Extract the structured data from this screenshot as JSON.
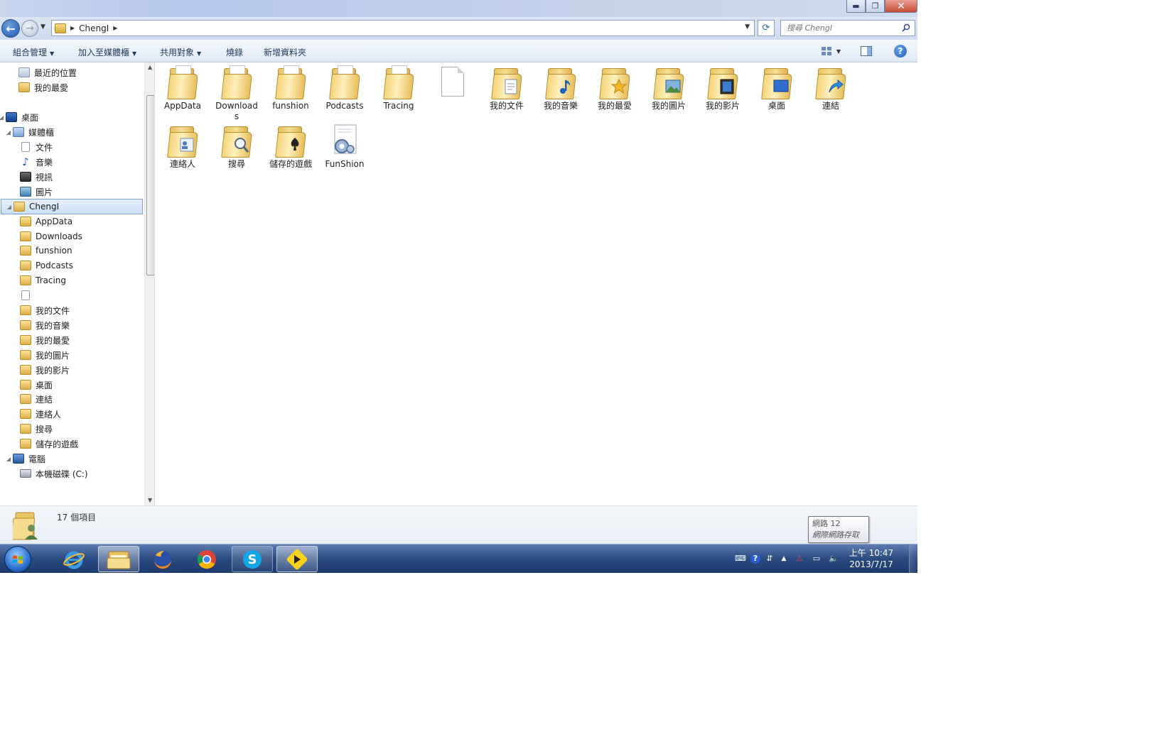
{
  "window": {
    "address_path": "ChengI",
    "search_placeholder": "搜尋 ChengI",
    "controls": {
      "minimize": "▬",
      "maximize": "❐",
      "close": "✕"
    }
  },
  "command_bar": {
    "organize": "組合管理",
    "add_to_library": "加入至媒體櫃",
    "share_with": "共用對象",
    "burn": "燒錄",
    "new_folder": "新增資料夾"
  },
  "nav_tree": [
    {
      "label": "最近的位置",
      "icon": "recent-places-icon"
    },
    {
      "label": "我的最愛",
      "icon": "favorites-icon"
    },
    {
      "label": "桌面",
      "icon": "desktop-icon",
      "expanded": true
    },
    {
      "label": "媒體櫃",
      "icon": "libraries-icon",
      "expanded": true
    },
    {
      "label": "文件",
      "icon": "document-icon"
    },
    {
      "label": "音樂",
      "icon": "music-icon"
    },
    {
      "label": "視訊",
      "icon": "video-icon"
    },
    {
      "label": "圖片",
      "icon": "picture-icon"
    },
    {
      "label": "ChengI",
      "icon": "user-folder-icon",
      "selected": true,
      "expanded": true
    },
    {
      "label": "AppData",
      "icon": "folder-icon"
    },
    {
      "label": "Downloads",
      "icon": "folder-icon"
    },
    {
      "label": "funshion",
      "icon": "folder-icon"
    },
    {
      "label": "Podcasts",
      "icon": "folder-icon"
    },
    {
      "label": "Tracing",
      "icon": "folder-icon"
    },
    {
      "label": "",
      "icon": "blank-file-icon"
    },
    {
      "label": "我的文件",
      "icon": "folder-icon"
    },
    {
      "label": "我的音樂",
      "icon": "folder-icon"
    },
    {
      "label": "我的最愛",
      "icon": "folder-icon"
    },
    {
      "label": "我的圖片",
      "icon": "folder-icon"
    },
    {
      "label": "我的影片",
      "icon": "folder-icon"
    },
    {
      "label": "桌面",
      "icon": "folder-icon"
    },
    {
      "label": "連結",
      "icon": "folder-icon"
    },
    {
      "label": "連絡人",
      "icon": "folder-icon"
    },
    {
      "label": "搜尋",
      "icon": "folder-icon"
    },
    {
      "label": "儲存的遊戲",
      "icon": "folder-icon"
    },
    {
      "label": "電腦",
      "icon": "computer-icon",
      "expanded": true
    },
    {
      "label": "本機磁碟 (C:)",
      "icon": "drive-icon"
    }
  ],
  "items": [
    {
      "label": "AppData",
      "icon": "folder-icon",
      "badge": ""
    },
    {
      "label": "Downloads",
      "icon": "folder-icon",
      "badge": ""
    },
    {
      "label": "funshion",
      "icon": "folder-icon",
      "badge": ""
    },
    {
      "label": "Podcasts",
      "icon": "folder-icon",
      "badge": ""
    },
    {
      "label": "Tracing",
      "icon": "folder-icon",
      "badge": ""
    },
    {
      "label": "",
      "icon": "blank-file-icon",
      "badge": ""
    },
    {
      "label": "我的文件",
      "icon": "documents-folder-icon",
      "badge": "doc"
    },
    {
      "label": "我的音樂",
      "icon": "music-folder-icon",
      "badge": "music"
    },
    {
      "label": "我的最愛",
      "icon": "favorites-folder-icon",
      "badge": "star"
    },
    {
      "label": "我的圖片",
      "icon": "pictures-folder-icon",
      "badge": "picture"
    },
    {
      "label": "我的影片",
      "icon": "videos-folder-icon",
      "badge": "video"
    },
    {
      "label": "桌面",
      "icon": "desktop-folder-icon",
      "badge": "desktop"
    },
    {
      "label": "連結",
      "icon": "links-folder-icon",
      "badge": "arrow"
    },
    {
      "label": "連絡人",
      "icon": "contacts-folder-icon",
      "badge": "contact"
    },
    {
      "label": "搜尋",
      "icon": "search-folder-icon",
      "badge": "search"
    },
    {
      "label": "儲存的遊戲",
      "icon": "saved-games-folder-icon",
      "badge": "game"
    },
    {
      "label": "FunShion",
      "icon": "settings-file-icon",
      "badge": "gear"
    }
  ],
  "details": {
    "item_count": "17 個項目"
  },
  "tooltip": {
    "line1": "網路 12",
    "line2": "網際網路存取"
  },
  "clock": {
    "time": "上午 10:47",
    "date": "2013/7/17"
  },
  "colors": {
    "accent": "#1d57b0",
    "taskbar": "#2b4a80",
    "selection": "#cce0f7",
    "folder": "#f4d37a"
  }
}
